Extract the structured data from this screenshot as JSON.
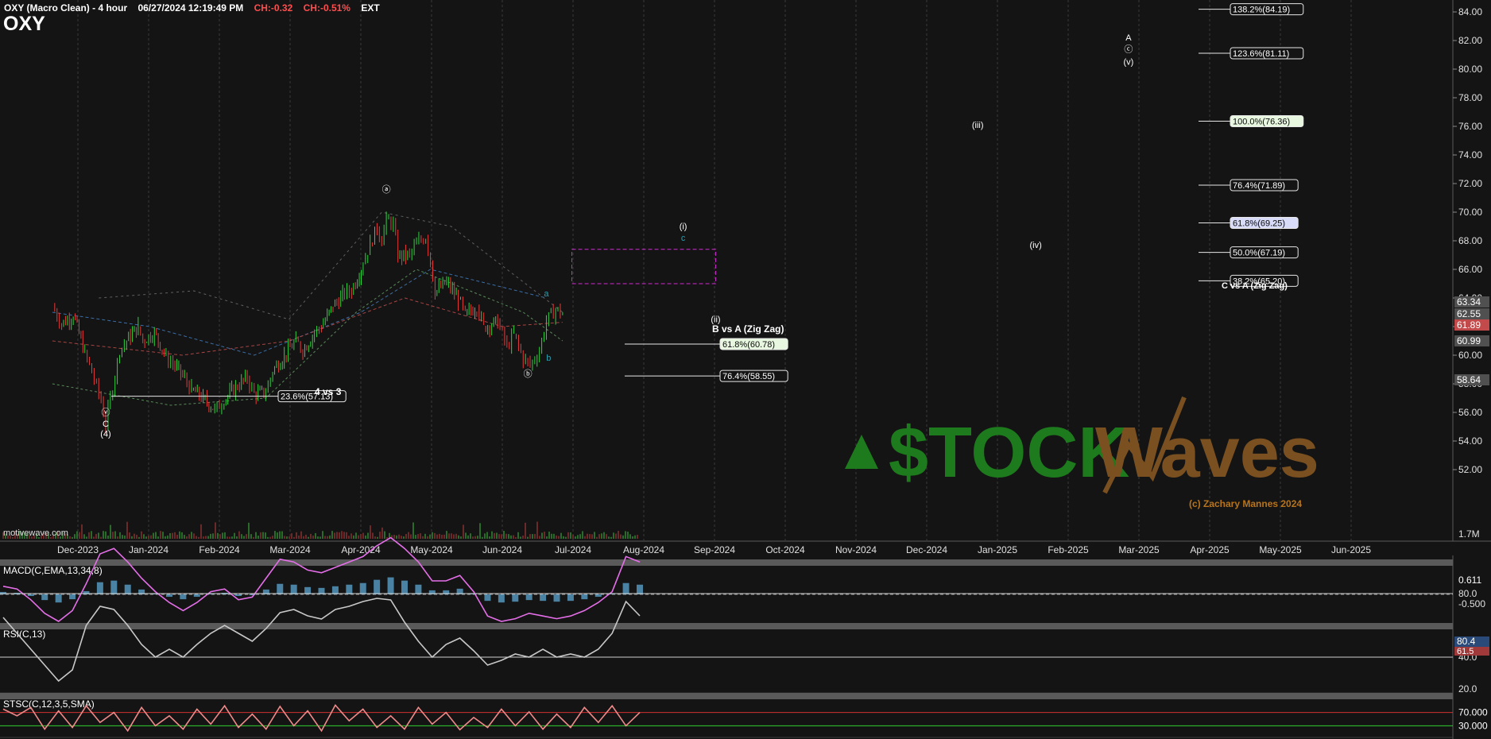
{
  "header": {
    "title": "OXY (Macro Clean) - 4 hour",
    "datetime": "06/27/2024 12:19:49 PM",
    "change": "CH:-0.32",
    "change_pct": "CH:-0.51%",
    "session": "EXT",
    "symbol": "OXY"
  },
  "watermark": {
    "site": "motivewave.com",
    "brand_left": "$TOCK",
    "brand_right": "Waves",
    "copyright": "(c) Zachary Mannes 2024"
  },
  "colors": {
    "background": "#141414",
    "up_candle": "#2fd23f",
    "down_candle": "#e83a3a",
    "macd": "#e46ee8",
    "macd_hist": "#5fb0e0",
    "rsi": "#c8c8c8",
    "stoch": "#f08a8a",
    "fib_box": "#d02ad0",
    "brand_green": "#1d7a1d",
    "brand_brown": "#7a5020"
  },
  "chart_data": [
    {
      "type": "candlestick",
      "x_axis_labels": [
        "Dec-2023",
        "Jan-2024",
        "Feb-2024",
        "Mar-2024",
        "Apr-2024",
        "May-2024",
        "Jun-2024",
        "Jul-2024",
        "Aug-2024",
        "Sep-2024",
        "Oct-2024",
        "Nov-2024",
        "Dec-2024",
        "Jan-2025",
        "Feb-2025",
        "Mar-2025",
        "Apr-2025",
        "May-2025",
        "Jun-2025"
      ],
      "y_ticks": [
        52,
        54,
        56,
        58,
        60,
        62,
        64,
        66,
        68,
        70,
        72,
        74,
        76,
        78,
        80,
        82,
        84
      ],
      "ylim": [
        50.5,
        85
      ],
      "volume_label": "1.7M",
      "price_path": [
        [
          "2023-11-20",
          63.4
        ],
        [
          "2023-11-24",
          62.2
        ],
        [
          "2023-11-29",
          62.8
        ],
        [
          "2023-12-04",
          60.2
        ],
        [
          "2023-12-07",
          58.8
        ],
        [
          "2023-12-11",
          56.8
        ],
        [
          "2023-12-13",
          55.1
        ],
        [
          "2023-12-15",
          57.0
        ],
        [
          "2023-12-19",
          60.3
        ],
        [
          "2023-12-22",
          61.0
        ],
        [
          "2023-12-27",
          62.0
        ],
        [
          "2023-12-29",
          61.0
        ],
        [
          "2024-01-03",
          61.6
        ],
        [
          "2024-01-08",
          59.9
        ],
        [
          "2024-01-11",
          59.4
        ],
        [
          "2024-01-16",
          58.4
        ],
        [
          "2024-01-19",
          57.6
        ],
        [
          "2024-01-24",
          57.0
        ],
        [
          "2024-01-29",
          56.2
        ],
        [
          "2024-02-02",
          56.8
        ],
        [
          "2024-02-07",
          57.8
        ],
        [
          "2024-02-12",
          58.4
        ],
        [
          "2024-02-15",
          57.3
        ],
        [
          "2024-02-20",
          57.4
        ],
        [
          "2024-02-23",
          58.9
        ],
        [
          "2024-02-28",
          60.0
        ],
        [
          "2024-03-04",
          61.0
        ],
        [
          "2024-03-07",
          60.3
        ],
        [
          "2024-03-12",
          61.6
        ],
        [
          "2024-03-15",
          62.0
        ],
        [
          "2024-03-20",
          63.4
        ],
        [
          "2024-03-25",
          64.3
        ],
        [
          "2024-03-28",
          64.5
        ],
        [
          "2024-04-02",
          66.4
        ],
        [
          "2024-04-05",
          67.8
        ],
        [
          "2024-04-08",
          68.9
        ],
        [
          "2024-04-10",
          68.0
        ],
        [
          "2024-04-12",
          69.5
        ],
        [
          "2024-04-15",
          69.2
        ],
        [
          "2024-04-17",
          66.9
        ],
        [
          "2024-04-22",
          67.0
        ],
        [
          "2024-04-25",
          67.8
        ],
        [
          "2024-04-29",
          68.3
        ],
        [
          "2024-05-01",
          66.6
        ],
        [
          "2024-05-03",
          64.4
        ],
        [
          "2024-05-08",
          65.1
        ],
        [
          "2024-05-13",
          63.9
        ],
        [
          "2024-05-16",
          62.8
        ],
        [
          "2024-05-21",
          63.4
        ],
        [
          "2024-05-24",
          62.0
        ],
        [
          "2024-05-30",
          62.3
        ],
        [
          "2024-06-03",
          60.6
        ],
        [
          "2024-06-06",
          61.5
        ],
        [
          "2024-06-10",
          59.7
        ],
        [
          "2024-06-13",
          59.3
        ],
        [
          "2024-06-17",
          60.3
        ],
        [
          "2024-06-20",
          62.4
        ],
        [
          "2024-06-24",
          63.2
        ],
        [
          "2024-06-27",
          62.9
        ]
      ],
      "last_price": 63.34,
      "price_boxes": [
        "63.34",
        "62.55",
        "61.89",
        "60.99",
        "58.64"
      ],
      "wave_labels": [
        {
          "text": "ⓥ",
          "date": "2023-12-13",
          "price": 55.8
        },
        {
          "text": "C",
          "date": "2023-12-13",
          "price": 55.0
        },
        {
          "text": "(4)",
          "date": "2023-12-13",
          "price": 54.3
        },
        {
          "text": "ⓐ",
          "date": "2024-04-12",
          "price": 71.4
        },
        {
          "text": "ⓑ",
          "date": "2024-06-12",
          "price": 58.5
        },
        {
          "text": "a",
          "date": "2024-06-20",
          "price": 64.1
        },
        {
          "text": "b",
          "date": "2024-06-21",
          "price": 59.6
        },
        {
          "text": "(i)",
          "date": "2024-08-18",
          "price": 68.8
        },
        {
          "text": "c",
          "date": "2024-08-18",
          "price": 68.0
        },
        {
          "text": "(ii)",
          "date": "2024-09-01",
          "price": 62.3
        },
        {
          "text": "(iii)",
          "date": "2024-12-23",
          "price": 75.9
        },
        {
          "text": "(iv)",
          "date": "2025-01-17",
          "price": 67.5
        },
        {
          "text": "A",
          "date": "2025-02-26",
          "price": 82.0
        },
        {
          "text": "ⓒ",
          "date": "2025-02-26",
          "price": 81.2
        },
        {
          "text": "(v)",
          "date": "2025-02-26",
          "price": 80.3
        }
      ],
      "fib_zigzag_label": "C vs A (Zig Zag)",
      "fib_levels": [
        {
          "label": "138.2%(84.19)",
          "price": 84.19
        },
        {
          "label": "123.6%(81.11)",
          "price": 81.11
        },
        {
          "label": "100.0%(76.36)",
          "price": 76.36
        },
        {
          "label": "76.4%(71.89)",
          "price": 71.89
        },
        {
          "label": "61.8%(69.25)",
          "price": 69.25
        },
        {
          "label": "50.0%(67.19)",
          "price": 67.19
        },
        {
          "label": "38.2%(65.20)",
          "price": 65.2
        }
      ],
      "b_vs_a": {
        "title": "B vs A (Zig Zag)",
        "levels": [
          {
            "label": "61.8%(60.78)",
            "price": 60.78
          },
          {
            "label": "76.4%(58.55)",
            "price": 58.55
          }
        ]
      },
      "four_vs_three": {
        "title": "4 vs 3",
        "level": {
          "label": "23.6%(57.13)",
          "price": 57.13
        }
      },
      "target_box": {
        "start": "2024-07-01",
        "end": "2024-09-01",
        "top": 67.4,
        "bottom": 65.0
      }
    },
    {
      "type": "line",
      "title": "MACD(C,EMA,13,34,8)",
      "y_ticks": [
        "0.611",
        "-0.500"
      ],
      "series": [
        {
          "name": "MACD",
          "values": [
            0.3,
            0.2,
            -0.2,
            -0.7,
            -1.0,
            -0.6,
            0.4,
            1.5,
            1.7,
            1.2,
            0.6,
            0.1,
            -0.3,
            -0.6,
            -0.3,
            0.1,
            0.2,
            -0.2,
            -0.1,
            0.6,
            1.3,
            1.2,
            0.9,
            0.8,
            1.0,
            1.2,
            1.4,
            1.8,
            2.1,
            1.7,
            1.2,
            0.5,
            0.5,
            0.7,
            0.1,
            -0.8,
            -1.0,
            -0.9,
            -0.7,
            -0.8,
            -0.9,
            -0.8,
            -0.6,
            -0.3,
            0.1,
            1.4,
            1.2
          ]
        }
      ]
    },
    {
      "type": "line",
      "title": "RSI(C,13)",
      "y_ticks": [
        "80.0",
        "40.0",
        "20.0"
      ],
      "value_boxes": [
        "80.4",
        "61.5"
      ],
      "series": [
        {
          "name": "RSI",
          "values": [
            65,
            55,
            45,
            35,
            25,
            32,
            60,
            72,
            70,
            60,
            48,
            40,
            45,
            40,
            48,
            55,
            60,
            55,
            50,
            58,
            68,
            70,
            66,
            64,
            70,
            72,
            75,
            77,
            76,
            62,
            50,
            40,
            48,
            52,
            44,
            35,
            38,
            42,
            40,
            45,
            40,
            42,
            40,
            45,
            55,
            75,
            66
          ]
        }
      ]
    },
    {
      "type": "line",
      "title": "STSC(C,12,3,5,SMA)",
      "y_ticks": [
        "70.000",
        "30.000"
      ],
      "series": [
        {
          "name": "STSC",
          "values": [
            80,
            60,
            85,
            20,
            75,
            25,
            90,
            40,
            70,
            15,
            85,
            30,
            60,
            20,
            80,
            35,
            90,
            25,
            65,
            20,
            88,
            30,
            75,
            15,
            92,
            45,
            80,
            25,
            60,
            20,
            85,
            35,
            70,
            18,
            55,
            25,
            80,
            30,
            72,
            20,
            65,
            25,
            85,
            40,
            90,
            30,
            70
          ]
        }
      ]
    }
  ]
}
